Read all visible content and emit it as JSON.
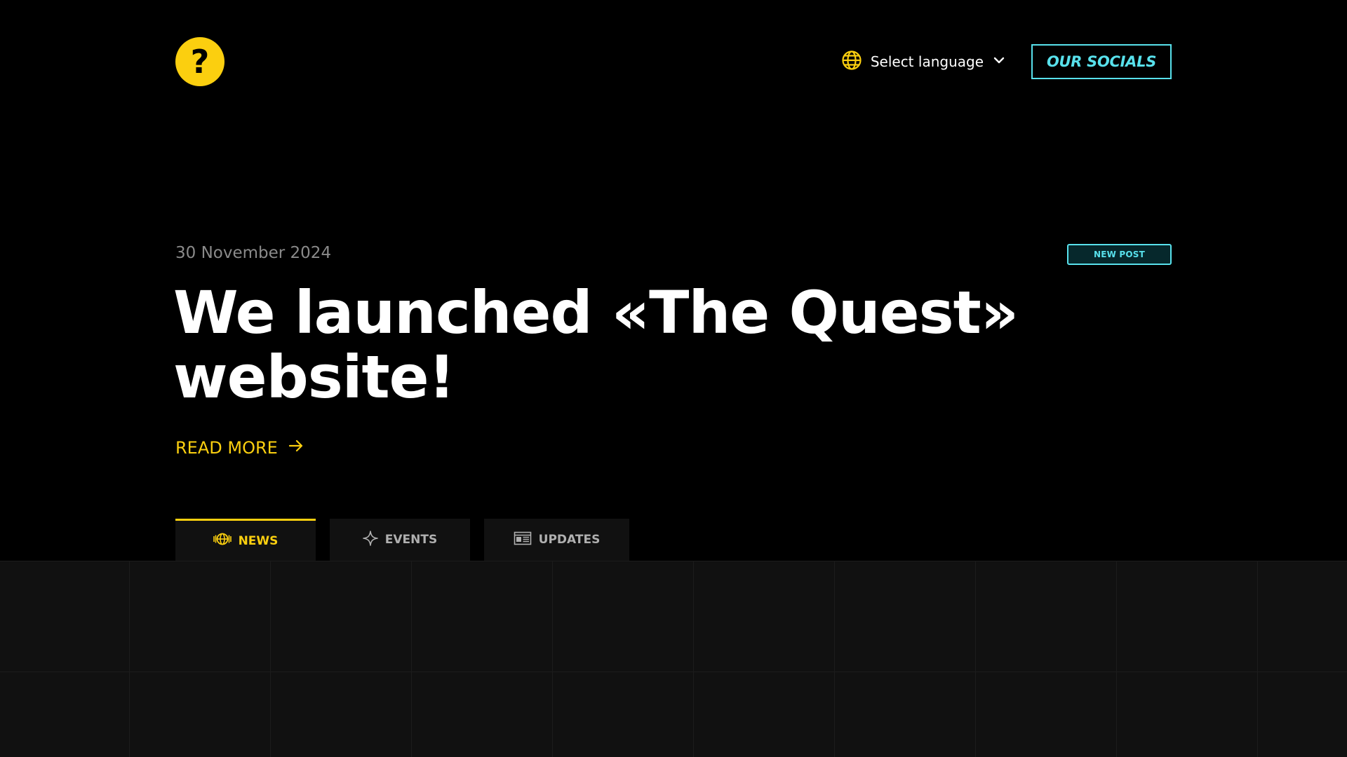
{
  "header": {
    "logo_symbol": "?",
    "language_label": "Select language",
    "socials_label": "OUR SOCIALS"
  },
  "hero": {
    "date": "30 November 2024",
    "badge": "NEW POST",
    "title": "We launched «The Quest» website!",
    "read_more": "READ MORE"
  },
  "tabs": [
    {
      "label": "NEWS",
      "icon": "globe-stripes-icon",
      "active": true
    },
    {
      "label": "EVENTS",
      "icon": "sparkle-icon",
      "active": false
    },
    {
      "label": "UPDATES",
      "icon": "newspaper-icon",
      "active": false
    }
  ],
  "colors": {
    "accent_yellow": "#fbcf0f",
    "accent_cyan": "#58e1ec",
    "background": "#000000",
    "panel": "#111111"
  }
}
